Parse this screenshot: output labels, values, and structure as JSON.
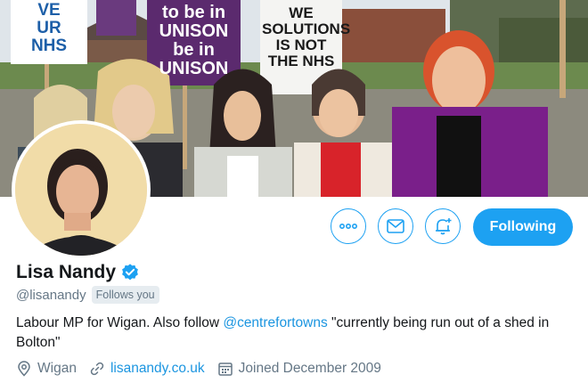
{
  "banner": {
    "signs": [
      "VE\nUR\nNHS",
      "to be in\nUNISON\nbe in\nUNISON",
      "WE\nSOLUTIONS\nIS NOT\nTHE NHS",
      "UNISON"
    ]
  },
  "profile": {
    "name": "Lisa Nandy",
    "handle": "@lisanandy",
    "follows_you": "Follows you",
    "bio_prefix": "Labour MP for Wigan. Also follow ",
    "bio_mention": "@centrefortowns",
    "bio_suffix": " \"currently being run out of a shed in Bolton\"",
    "location": "Wigan",
    "website": "lisanandy.co.uk",
    "joined": "Joined December 2009"
  },
  "actions": {
    "more_icon": "more-icon",
    "message_icon": "envelope-icon",
    "notify_icon": "bell-plus-icon",
    "following_label": "Following"
  },
  "colors": {
    "accent": "#1da1f2",
    "link": "#1b95e0",
    "secondary_text": "#657786",
    "badge_bg": "#e6ecf0"
  }
}
